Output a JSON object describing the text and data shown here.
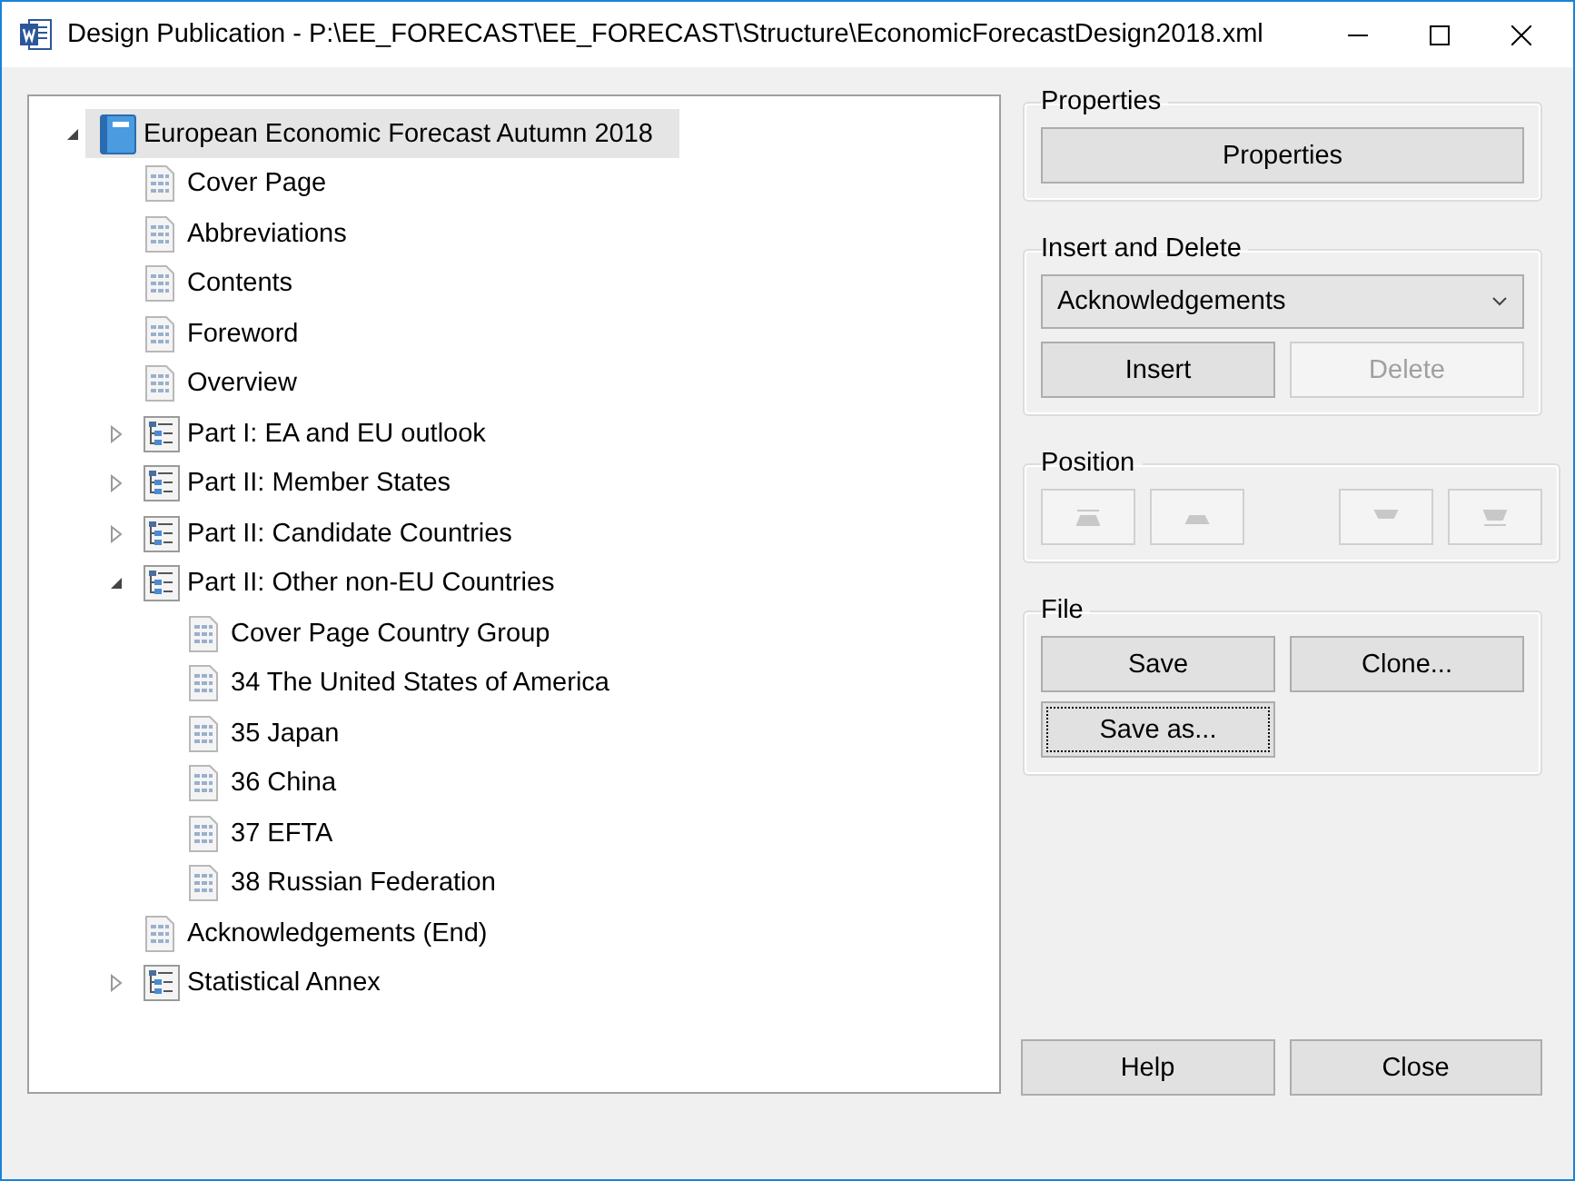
{
  "window": {
    "title": "Design Publication - P:\\EE_FORECAST\\EE_FORECAST\\Structure\\EconomicForecastDesign2018.xml"
  },
  "tree": [
    {
      "kind": "book",
      "label": "European Economic Forecast Autumn 2018",
      "selected": true,
      "expanded": true,
      "children": [
        {
          "kind": "page",
          "label": "Cover Page",
          "selected": false
        },
        {
          "kind": "page",
          "label": "Abbreviations",
          "selected": false
        },
        {
          "kind": "page",
          "label": "Contents",
          "selected": false
        },
        {
          "kind": "page",
          "label": "Foreword",
          "selected": false
        },
        {
          "kind": "page",
          "label": "Overview",
          "selected": false
        },
        {
          "kind": "section",
          "label": "Part I: EA and EU outlook",
          "selected": false,
          "expanded": false
        },
        {
          "kind": "section",
          "label": "Part II: Member States",
          "selected": false,
          "expanded": false
        },
        {
          "kind": "section",
          "label": "Part II: Candidate Countries",
          "selected": false,
          "expanded": false
        },
        {
          "kind": "section",
          "label": "Part II: Other non-EU Countries",
          "selected": false,
          "expanded": true,
          "children": [
            {
              "kind": "page",
              "label": "Cover Page Country Group",
              "selected": false
            },
            {
              "kind": "page",
              "label": "34 The United States of America",
              "selected": false
            },
            {
              "kind": "page",
              "label": "35 Japan",
              "selected": false
            },
            {
              "kind": "page",
              "label": "36 China",
              "selected": false
            },
            {
              "kind": "page",
              "label": "37 EFTA",
              "selected": false
            },
            {
              "kind": "page",
              "label": "38 Russian Federation",
              "selected": false
            }
          ]
        },
        {
          "kind": "page",
          "label": "Acknowledgements (End)",
          "selected": false
        },
        {
          "kind": "section",
          "label": "Statistical Annex",
          "selected": false,
          "expanded": false
        }
      ]
    }
  ],
  "properties": {
    "title": "Properties",
    "button": "Properties"
  },
  "insert_delete": {
    "title": "Insert and Delete",
    "dropdown": "Acknowledgements",
    "buttons": [
      {
        "label": "Insert",
        "disabled": false
      },
      {
        "label": "Delete",
        "disabled": true
      }
    ]
  },
  "position": {
    "title": "Position",
    "buttons": [
      {
        "kind": "top",
        "disabled": true
      },
      {
        "kind": "up",
        "disabled": true
      },
      {
        "kind": "down",
        "disabled": true
      },
      {
        "kind": "bottom",
        "disabled": true
      }
    ]
  },
  "file": {
    "title": "File",
    "buttons": [
      {
        "label": "Save",
        "focused": false
      },
      {
        "label": "Clone...",
        "focused": false
      },
      {
        "label": "Save as...",
        "focused": true
      }
    ]
  },
  "footer_buttons": [
    "Help",
    "Close"
  ]
}
